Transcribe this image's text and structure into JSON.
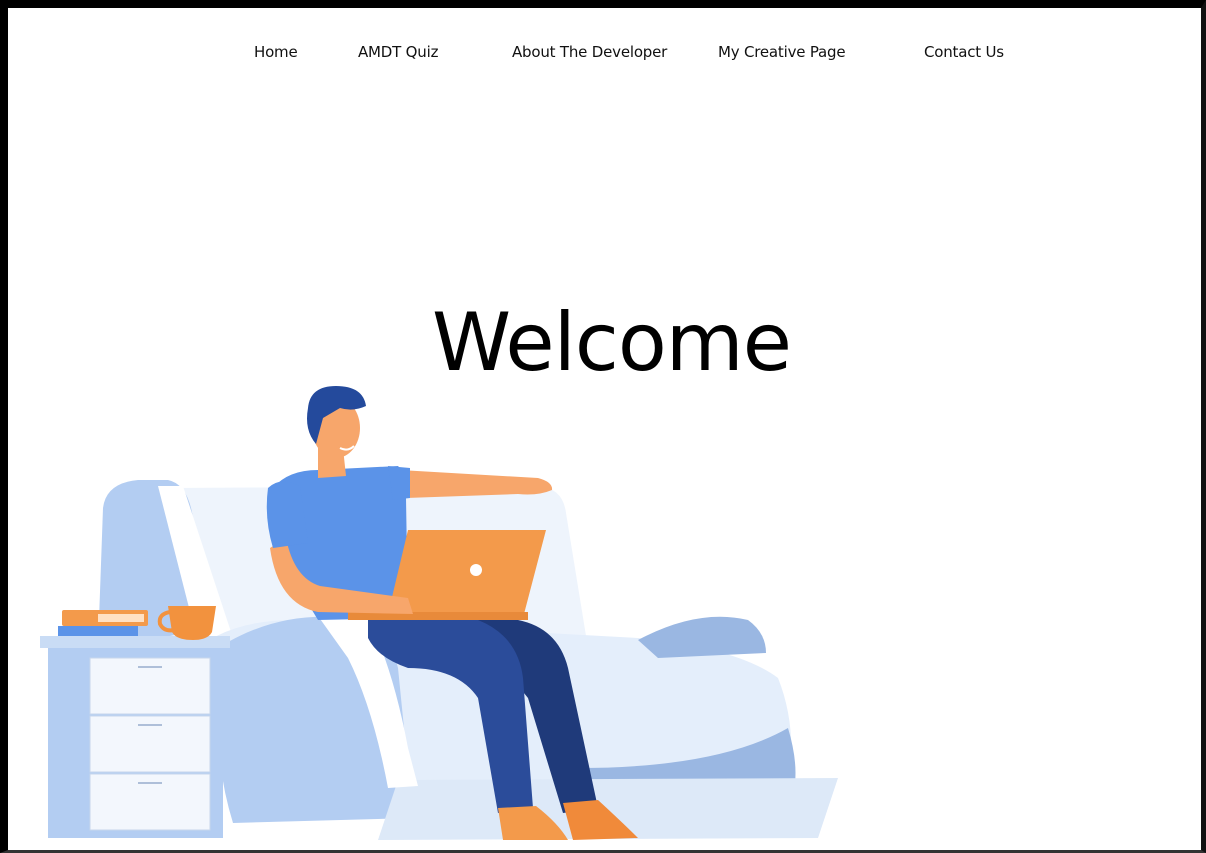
{
  "nav": {
    "items": [
      {
        "label": "Home"
      },
      {
        "label": "AMDT Quiz"
      },
      {
        "label": "About The Developer"
      },
      {
        "label": "My Creative Page"
      },
      {
        "label": "Contact Us"
      }
    ]
  },
  "hero": {
    "title": "Welcome"
  },
  "colors": {
    "sofa_light": "#eef4fc",
    "sofa_mid": "#b3cdf2",
    "sofa_dark": "#9ab7e2",
    "shirt": "#5b93e8",
    "pants": "#2b4c9a",
    "pants_dark": "#1f3a7a",
    "hair": "#244a9c",
    "skin": "#f7a66b",
    "laptop": "#f39a4b",
    "mug": "#f2923e"
  }
}
